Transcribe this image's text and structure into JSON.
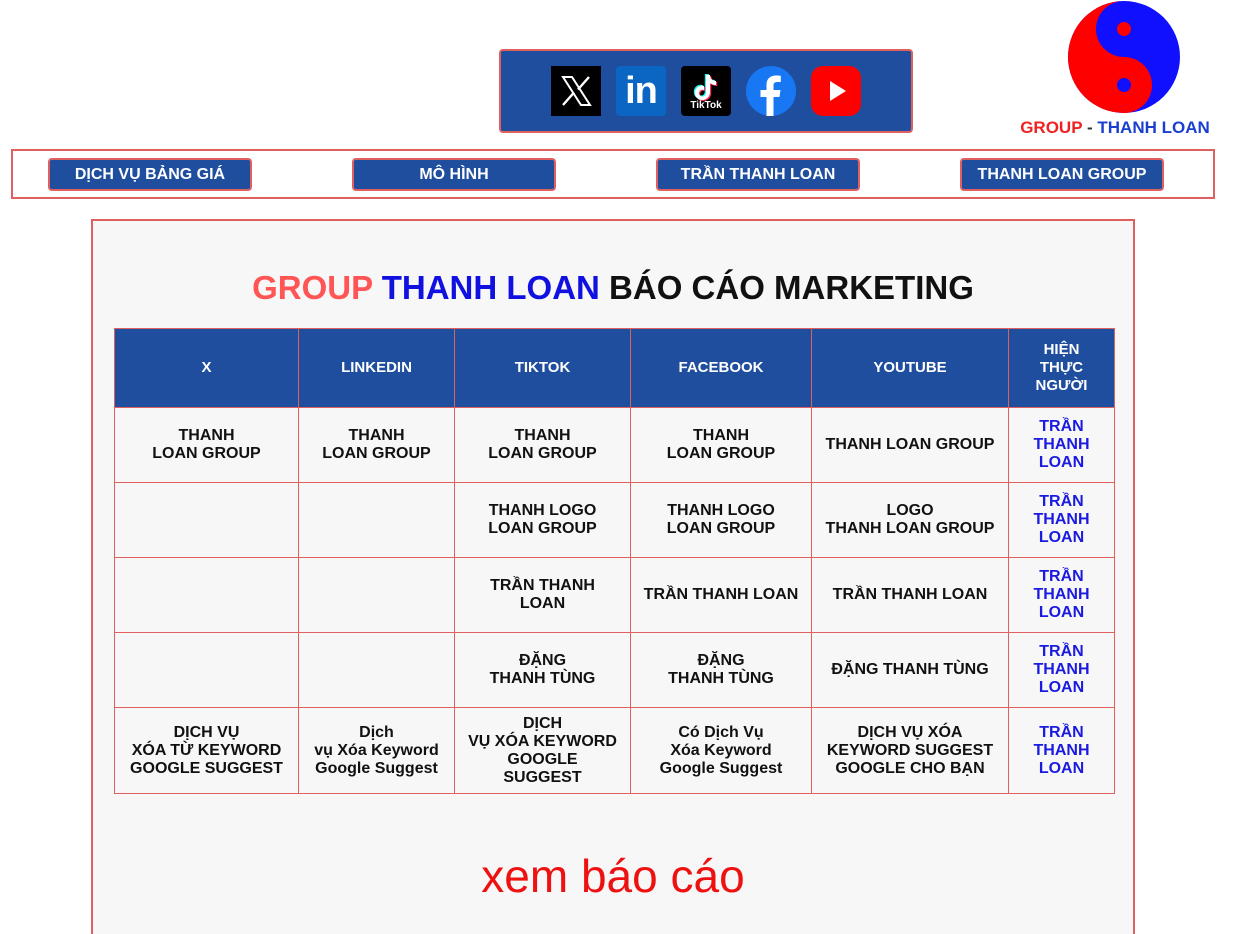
{
  "social": {
    "icons": [
      "x-icon",
      "linkedin-icon",
      "tiktok-icon",
      "facebook-icon",
      "youtube-icon"
    ],
    "linkedin_text": "in",
    "tiktok_text": "TikTok"
  },
  "logo": {
    "group": "GROUP",
    "dash": "-",
    "name": "THANH LOAN"
  },
  "nav": {
    "items": [
      "DỊCH VỤ BẢNG GIÁ",
      "MÔ HÌNH",
      "TRẦN THANH LOAN",
      "THANH LOAN GROUP"
    ]
  },
  "report": {
    "title_red": "GROUP",
    "title_blue": "THANH LOAN",
    "title_black": "BÁO CÁO MARKETING",
    "headers": [
      "X",
      "LINKEDIN",
      "TIKTOK",
      "FACEBOOK",
      "YOUTUBE",
      "HIỆN THỰC NGƯỜI"
    ],
    "rows": [
      [
        "THANH\nLOAN GROUP",
        "THANH\nLOAN GROUP",
        "THANH\nLOAN GROUP",
        "THANH\nLOAN GROUP",
        "THANH LOAN GROUP",
        "TRẦN\nTHANH\nLOAN"
      ],
      [
        "",
        "",
        "THANH LOGO\nLOAN GROUP",
        "THANH LOGO\nLOAN GROUP",
        "LOGO\nTHANH LOAN GROUP",
        "TRẦN\nTHANH\nLOAN"
      ],
      [
        "",
        "",
        "TRẦN THANH LOAN",
        "TRẦN THANH LOAN",
        "TRẦN THANH LOAN",
        "TRẦN\nTHANH\nLOAN"
      ],
      [
        "",
        "",
        "ĐẶNG\nTHANH TÙNG",
        "ĐẶNG\nTHANH TÙNG",
        "ĐẶNG THANH TÙNG",
        "TRẦN\nTHANH\nLOAN"
      ],
      [
        "DỊCH VỤ\nXÓA TỪ KEYWORD\nGOOGLE SUGGEST",
        "Dịch\nvụ Xóa Keyword\nGoogle Suggest",
        "DỊCH\nVỤ XÓA KEYWORD\nGOOGLE SUGGEST",
        "Có Dịch Vụ\nXóa Keyword\nGoogle Suggest",
        "DỊCH VỤ XÓA\nKEYWORD SUGGEST\nGOOGLE CHO BẠN",
        "TRẦN\nTHANH\nLOAN"
      ]
    ]
  },
  "footer_link": "xem báo cáo",
  "colors": {
    "primary_blue": "#1f4e9e",
    "border_red": "#e06060",
    "accent_red": "#ee1111"
  }
}
